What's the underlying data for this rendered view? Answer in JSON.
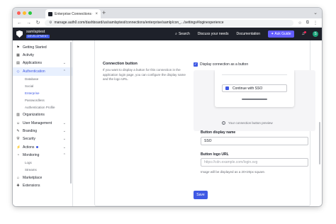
{
  "browser": {
    "tab_title": "Enterprise Connections - Sa",
    "tab_close": "×",
    "new_tab": "+",
    "tab_menu": "⌄",
    "url": "manage.auth0.com/dashboard/us/samlsptest/connections/enterprise/samlp/con_.../settings#loginexperience",
    "nav": {
      "back": "←",
      "forward": "→",
      "reload": "↻"
    }
  },
  "topbar": {
    "tenant_name": "samlsptest",
    "tenant_env": "DEVELOPMENT",
    "search_label": "Search",
    "discuss_label": "Discuss your needs",
    "docs_label": "Documentation",
    "ask_guide_label": "Ask Guide",
    "avatar_initial": "S"
  },
  "sidebar": {
    "items": [
      {
        "label": "Getting Started",
        "icon": "⚑"
      },
      {
        "label": "Activity",
        "icon": "▦"
      },
      {
        "label": "Applications",
        "icon": "▤",
        "chevron": "⌄"
      },
      {
        "label": "Authentication",
        "icon": "◇",
        "chevron": "⌃"
      }
    ],
    "sub_items": [
      "Database",
      "Social",
      "Enterprise",
      "Passwordless",
      "Authentication Profile"
    ],
    "items_after": [
      {
        "label": "Organizations",
        "icon": "▥"
      },
      {
        "label": "User Management",
        "icon": "☺",
        "chevron": "⌄"
      },
      {
        "label": "Branding",
        "icon": "✎",
        "chevron": "⌄"
      },
      {
        "label": "Security",
        "icon": "⛨",
        "chevron": "⌄"
      },
      {
        "label": "Actions",
        "icon": "⚡",
        "chevron": "⌄"
      },
      {
        "label": "Monitoring",
        "icon": "◔",
        "chevron": "⌃"
      }
    ],
    "monitoring_sub": [
      "Logs",
      "Streams"
    ],
    "items_end": [
      {
        "label": "Marketplace",
        "icon": "⌂"
      },
      {
        "label": "Extensions",
        "icon": "✚"
      }
    ],
    "collapse_label": "«"
  },
  "content": {
    "section_title": "Connection button",
    "section_desc": "If you want to display a button for this connection in the application login page, you can configure the display name and the logo URL.",
    "checkbox_label": "Display connection as a button",
    "preview_button_text": "Continue with SSO",
    "preview_caption": "Your connection button preview",
    "display_name_label": "Button display name",
    "display_name_value": "SSO",
    "logo_url_label": "Button logo URL",
    "logo_url_placeholder": "https://cdn.example.com/login.svg",
    "logo_help": "Image will be displayed as a 20×20px square.",
    "save_label": "Save"
  },
  "colors": {
    "accent": "#3f59e4",
    "topbar_bg": "#1e212a",
    "ask_guide_bg": "#635dff"
  }
}
